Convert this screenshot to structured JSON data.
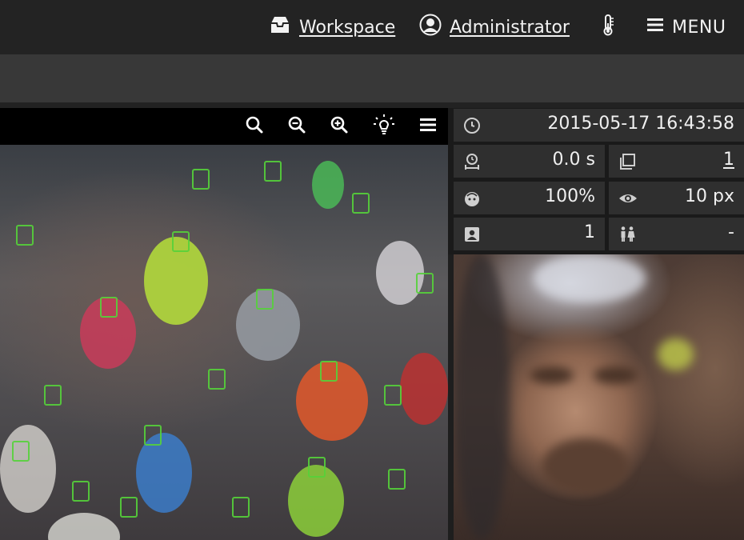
{
  "topbar": {
    "workspace_label": "Workspace",
    "admin_label": "Administrator",
    "menu_label": "MENU"
  },
  "toolbar": {
    "icons": [
      "search-icon",
      "zoom-out-icon",
      "zoom-in-icon",
      "brightness-icon",
      "list-menu-icon"
    ]
  },
  "info": {
    "timestamp": "2015-05-17 16:43:58",
    "duration": "0.0 s",
    "frame_count": "1",
    "face_quality": "100%",
    "min_size": "10 px",
    "person_count": "1",
    "group_value": "-"
  },
  "colors": {
    "accent_face_box": "#55d23a",
    "panel_cell": "#2f2f2f",
    "topbar": "#232323"
  }
}
